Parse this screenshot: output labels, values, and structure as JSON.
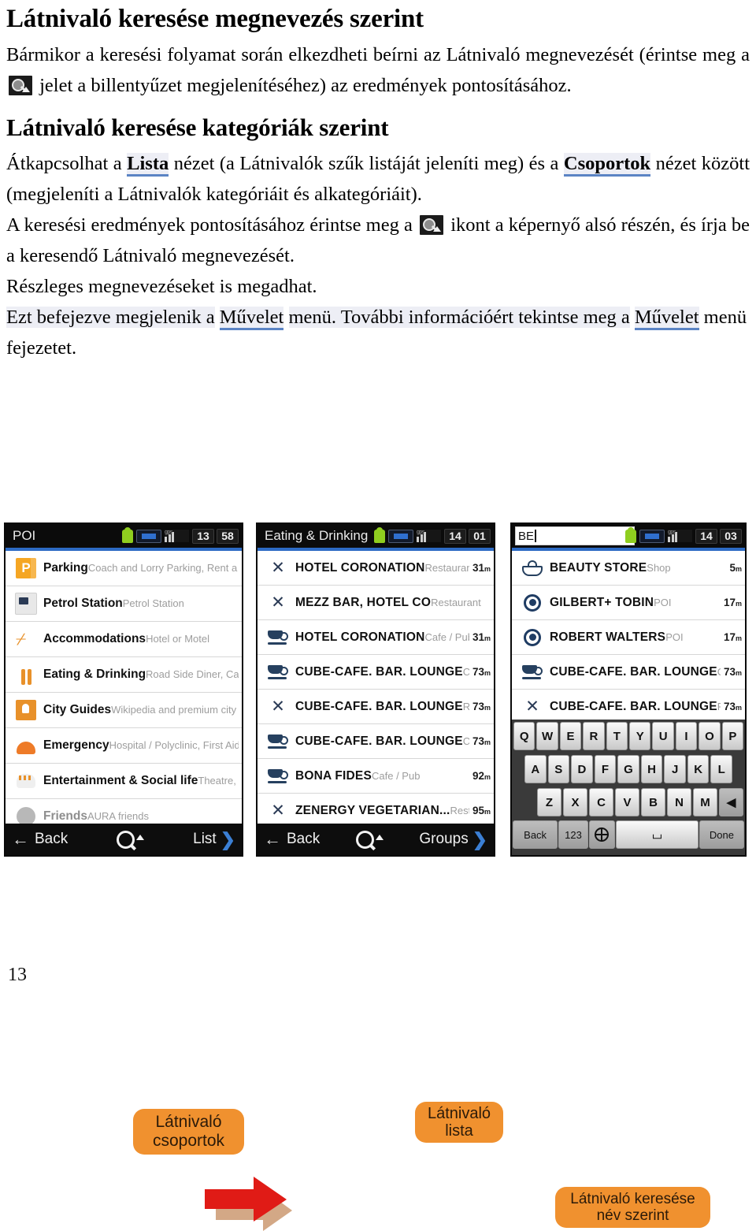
{
  "document": {
    "page_number": "13",
    "sections": [
      {
        "heading": "Látnivaló keresése megnevezés szerint",
        "para_before_icon": "Bármikor a keresési folyamat során elkezdheti beírni az Látnivaló megnevezését (érintse meg a",
        "para_after_icon": "jelet a billentyűzet megjelenítéséhez) az eredmények pontosításához."
      },
      {
        "heading": "Látnivaló keresése kategóriák szerint",
        "p1_a": "Átkapcsolhat a",
        "p1_link1": "Lista",
        "p1_b": "nézet (a Látnivalók szűk listáját jeleníti meg) és a",
        "p1_link2": "Csoportok",
        "p1_c": "nézet között (megjeleníti a Látnivalók kategóriáit és alkategóriáit).",
        "p2_a": "A keresési eredmények pontosításához érintse meg a",
        "p2_b": "ikont a képernyő alsó részén, és írja be a keresendő Látnivaló megnevezését.",
        "p3": "Részleges megnevezéseket is megadhat.",
        "p4_a": "Ezt befejezve megjelenik a",
        "p4_link1": "Művelet",
        "p4_b": "menü. További információért tekintse meg a",
        "p4_link2": "Művelet",
        "p4_c": "menü",
        "p5": "fejezetet."
      }
    ]
  },
  "colors": {
    "callout_bg": "#f0912f",
    "callout_text": "#2b1a09",
    "link_underline": "#5b84c4",
    "link_highlight": "#edeef5",
    "arrow_red": "#e01b16",
    "arrow_shadow": "#d3a886",
    "status_blue": "#2d6bc4",
    "chevron_blue": "#3b7fd4"
  },
  "callouts": [
    {
      "id": "callout1",
      "line1": "Látnivaló",
      "line2": "csoportok"
    },
    {
      "id": "callout2",
      "line1": "Látnivaló",
      "line2": "lista"
    },
    {
      "id": "callout3",
      "line1": "Látnivaló keresése",
      "line2": "név szerint"
    }
  ],
  "phone1": {
    "status": {
      "title": "POI",
      "hours": "13",
      "minutes": "58"
    },
    "rows": [
      {
        "icon": "parking-icon",
        "title": "Parking",
        "subtitle": "Coach and Lorry Parking, Rent a Car Parki...",
        "faded": false
      },
      {
        "icon": "petrol-icon",
        "title": "Petrol Station",
        "subtitle": "Petrol Station",
        "faded": false
      },
      {
        "icon": "accommodation-icon",
        "title": "Accommodations",
        "subtitle": "Hotel or Motel",
        "faded": false
      },
      {
        "icon": "eating-icon",
        "title": "Eating & Drinking",
        "subtitle": "Road Side Diner, Cafe / Pub, Restaurant",
        "faded": false
      },
      {
        "icon": "city-guides-icon",
        "title": "City Guides",
        "subtitle": "Wikipedia and premium city guides",
        "faded": false
      },
      {
        "icon": "emergency-icon",
        "title": "Emergency",
        "subtitle": "Hospital / Polyclinic, First Aid Post, Pharmac...",
        "faded": false
      },
      {
        "icon": "entertainment-icon",
        "title": "Entertainment & Social life",
        "subtitle": "Theatre, Cultural Center, Casino, Cinema,...",
        "faded": false
      },
      {
        "icon": "friends-icon",
        "title": "Friends",
        "subtitle": "AURA friends",
        "faded": true
      }
    ],
    "bottom": {
      "back": "Back",
      "right": "List"
    }
  },
  "phone2": {
    "status": {
      "title": "Eating & Drinking",
      "hours": "14",
      "minutes": "01"
    },
    "rows": [
      {
        "icon": "fork-knife-icon",
        "title": "HOTEL CORONATION",
        "subtitle": "Restaurant",
        "distance": "31",
        "unit": "m"
      },
      {
        "icon": "fork-knife-icon",
        "title": "MEZZ BAR, HOTEL CO",
        "subtitle": "Restaurant",
        "distance": "",
        "unit": ""
      },
      {
        "icon": "cup-icon",
        "title": "HOTEL CORONATION",
        "subtitle": "Cafe / Pub",
        "distance": "31",
        "unit": "m"
      },
      {
        "icon": "cup-icon",
        "title": "CUBE-CAFE. BAR. LOUNGE",
        "subtitle": "Cafe / Pub",
        "distance": "73",
        "unit": "m"
      },
      {
        "icon": "fork-knife-icon",
        "title": "CUBE-CAFE. BAR. LOUNGE",
        "subtitle": "Restaurant",
        "distance": "73",
        "unit": "m"
      },
      {
        "icon": "cup-icon",
        "title": "CUBE-CAFE. BAR. LOUNGE",
        "subtitle": "Cafe / Pub",
        "distance": "73",
        "unit": "m"
      },
      {
        "icon": "cup-icon",
        "title": "BONA FIDES",
        "subtitle": "Cafe / Pub",
        "distance": "92",
        "unit": "m"
      },
      {
        "icon": "fork-knife-icon",
        "title": "ZENERGY VEGETARIAN...",
        "subtitle": "Restaurant",
        "distance": "95",
        "unit": "m"
      }
    ],
    "bottom": {
      "back": "Back",
      "right": "Groups"
    }
  },
  "phone3": {
    "status": {
      "search_value": "BE",
      "search_placeholder": "",
      "hours": "14",
      "minutes": "03"
    },
    "rows": [
      {
        "icon": "basket-icon",
        "title": "BEAUTY STORE",
        "subtitle": "Shop",
        "distance": "5",
        "unit": "m"
      },
      {
        "icon": "target-icon",
        "title": "GILBERT+ TOBIN",
        "subtitle": "POI",
        "distance": "17",
        "unit": "m"
      },
      {
        "icon": "target-icon",
        "title": "ROBERT WALTERS",
        "subtitle": "POI",
        "distance": "17",
        "unit": "m"
      },
      {
        "icon": "cup-icon",
        "title": "CUBE-CAFE. BAR. LOUNGE",
        "subtitle": "Cafe / Pub",
        "distance": "73",
        "unit": "m"
      },
      {
        "icon": "fork-knife-icon",
        "title": "CUBE-CAFE. BAR. LOUNGE",
        "subtitle": "Restaurant",
        "distance": "73",
        "unit": "m"
      }
    ],
    "keyboard": {
      "row1": [
        "Q",
        "W",
        "E",
        "R",
        "T",
        "Y",
        "U",
        "I",
        "O",
        "P"
      ],
      "row2": [
        "A",
        "S",
        "D",
        "F",
        "G",
        "H",
        "J",
        "K",
        "L"
      ],
      "row3": [
        "Z",
        "X",
        "C",
        "V",
        "B",
        "N",
        "M"
      ],
      "backspace": "◀",
      "back": "Back",
      "numbers": "123",
      "globe": "globe-icon",
      "space": "⌴",
      "done": "Done"
    }
  }
}
